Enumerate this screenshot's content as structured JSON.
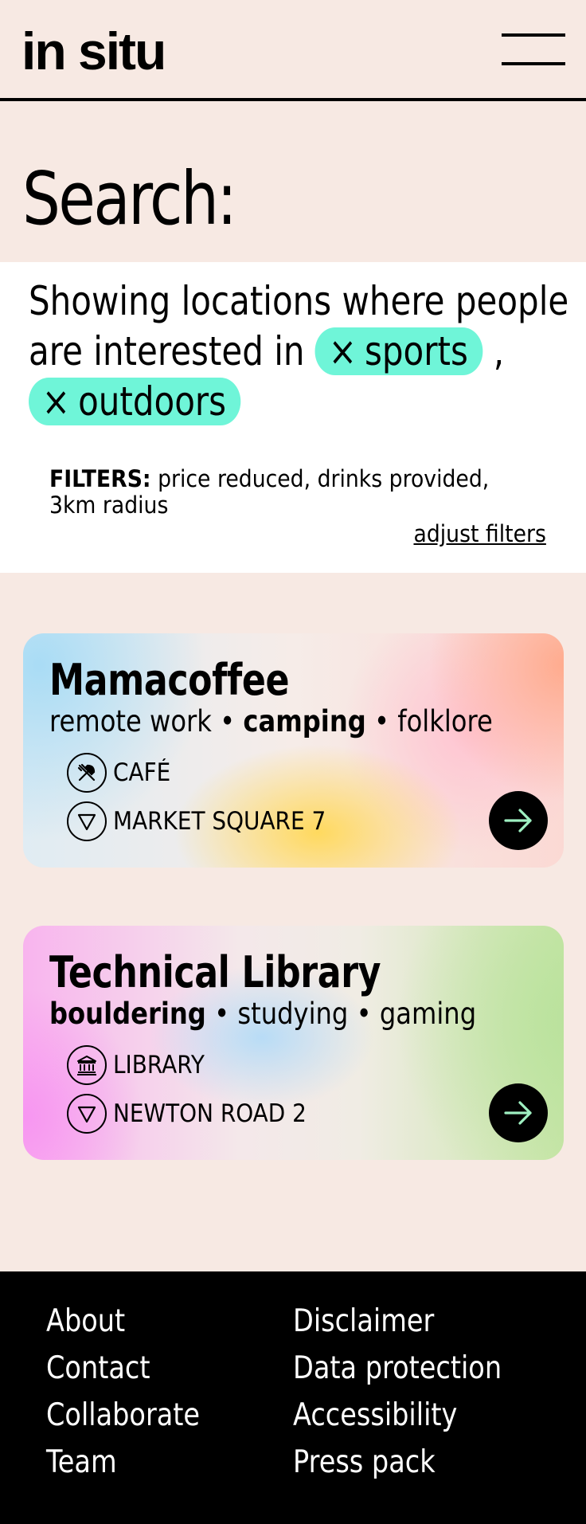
{
  "header": {
    "logo": "in situ",
    "menu_icon": "hamburger-menu-icon"
  },
  "search": {
    "title": "Search:",
    "query_prefix": "Showing locations where people are interested in",
    "tags": [
      {
        "remove_symbol": "×",
        "label": "sports"
      },
      {
        "remove_symbol": "×",
        "label": "outdoors"
      }
    ],
    "tag_separator": ",",
    "tag_color": "#6ff5d8",
    "filters_label": "FILTERS:",
    "filters_value": "price reduced, drinks provided, 3km radius",
    "adjust_link": "adjust filters"
  },
  "results": [
    {
      "title": "Mamacoffee",
      "interests": [
        {
          "label": "remote work",
          "bold": false
        },
        {
          "label": "camping",
          "bold": true
        },
        {
          "label": "folklore",
          "bold": false
        }
      ],
      "separator": "•",
      "type_icon": "utensils-icon",
      "type": "CAFÉ",
      "address_icon": "location-triangle-icon",
      "address": "MARKET SQUARE 7",
      "arrow_icon": "arrow-right-icon"
    },
    {
      "title": "Technical Library",
      "interests": [
        {
          "label": "bouldering",
          "bold": true
        },
        {
          "label": "studying",
          "bold": false
        },
        {
          "label": "gaming",
          "bold": false
        }
      ],
      "separator": "•",
      "type_icon": "library-building-icon",
      "type": "LIBRARY",
      "address_icon": "location-triangle-icon",
      "address": "NEWTON ROAD 2",
      "arrow_icon": "arrow-right-icon"
    }
  ],
  "footer": {
    "left": [
      "About",
      "Contact",
      "Collaborate",
      "Team"
    ],
    "right": [
      "Disclaimer",
      "Data protection",
      "Accessibility",
      "Press pack"
    ]
  },
  "colors": {
    "background": "#f7e9e3",
    "panel": "#ffffff",
    "footer": "#000000",
    "arrow_accent": "#9ff0c2"
  }
}
